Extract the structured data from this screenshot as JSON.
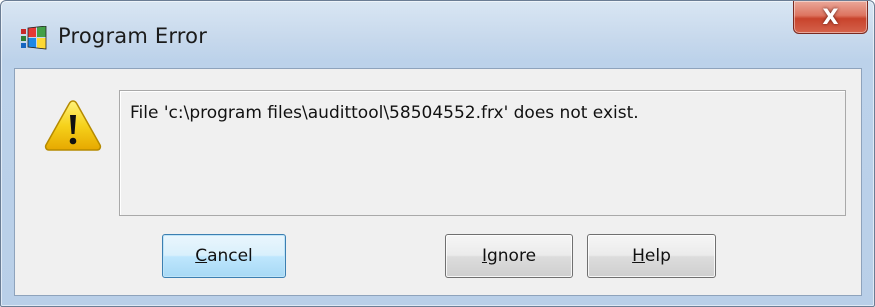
{
  "window": {
    "title": "Program Error",
    "close_label": "X"
  },
  "message": {
    "text": "File 'c:\\program files\\audittool\\58504552.frx' does not exist."
  },
  "buttons": {
    "cancel": {
      "mnemonic": "C",
      "rest": "ancel"
    },
    "ignore": {
      "mnemonic": "I",
      "rest": "gnore"
    },
    "help": {
      "mnemonic": "H",
      "rest": "elp"
    }
  },
  "icons": {
    "app": "windows-app-icon",
    "warning": "warning-icon",
    "close": "close-icon"
  },
  "colors": {
    "close_button": "#c8432c",
    "warning_yellow": "#f4c20d",
    "default_button_border": "#3c7fb1"
  }
}
